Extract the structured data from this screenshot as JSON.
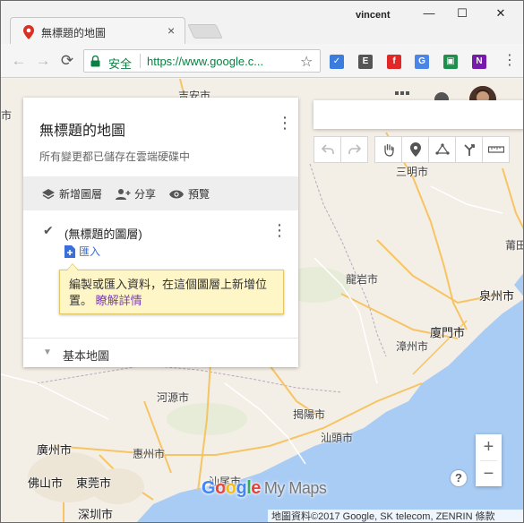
{
  "browser": {
    "tab_title": "無標題的地圖",
    "tab_close": "×",
    "user": "vincent",
    "window_controls": {
      "minimize": "—",
      "maximize": "☐",
      "close": "✕"
    },
    "nav": {
      "back": "←",
      "forward": "→",
      "reload": "⟳"
    },
    "omnibox": {
      "secure_label": "安全",
      "url": "https://www.google.c...",
      "star": "☆"
    },
    "extensions": [
      {
        "name": "check-extension",
        "color": "#3b7ddd",
        "glyph": "✓"
      },
      {
        "name": "evernote-extension",
        "color": "#555555",
        "glyph": "E"
      },
      {
        "name": "flipboard-extension",
        "color": "#e12828",
        "glyph": "f"
      },
      {
        "name": "translate-extension",
        "color": "#4a86e8",
        "glyph": "G"
      },
      {
        "name": "classroom-extension",
        "color": "#1f8f4e",
        "glyph": "▣"
      },
      {
        "name": "onenote-extension",
        "color": "#7719aa",
        "glyph": "N"
      }
    ],
    "menu": "⋮"
  },
  "panel": {
    "title": "無標題的地圖",
    "status": "所有變更都已儲存在雲端硬碟中",
    "actions": {
      "add_layer": "新增圖層",
      "share": "分享",
      "preview": "預覽"
    },
    "layer": {
      "name": "(無標題的圖層)",
      "import": "匯入"
    },
    "tooltip": {
      "text": "編製或匯入資料，在這個圖層上新增位置。",
      "link": "瞭解詳情"
    },
    "basemap": "基本地圖"
  },
  "map": {
    "cities": [
      {
        "id": "jian",
        "name": "吉安市"
      },
      {
        "id": "sanming",
        "name": "三明市"
      },
      {
        "id": "putian",
        "name": "莆田"
      },
      {
        "id": "longyan",
        "name": "龍岩市"
      },
      {
        "id": "quanzhou",
        "name": "泉州市"
      },
      {
        "id": "xiamen",
        "name": "廈門市"
      },
      {
        "id": "zhangzhou",
        "name": "漳州市"
      },
      {
        "id": "heyuan",
        "name": "河源市"
      },
      {
        "id": "jieyang",
        "name": "揭陽市"
      },
      {
        "id": "shantou",
        "name": "汕頭市"
      },
      {
        "id": "guangzhou",
        "name": "廣州市"
      },
      {
        "id": "huizhou",
        "name": "惠州市"
      },
      {
        "id": "foshan",
        "name": "佛山市"
      },
      {
        "id": "dongguan",
        "name": "東莞市"
      },
      {
        "id": "shenzhen",
        "name": "深圳市"
      },
      {
        "id": "shanwei",
        "name": "汕尾市"
      },
      {
        "id": "edge-left",
        "name": "市"
      }
    ],
    "logo": {
      "google": "Google",
      "product": "My Maps"
    },
    "attribution": "地圖資料©2017 Google, SK telecom, ZENRIN   條款",
    "zoom_in": "+",
    "zoom_out": "−",
    "help": "?"
  }
}
